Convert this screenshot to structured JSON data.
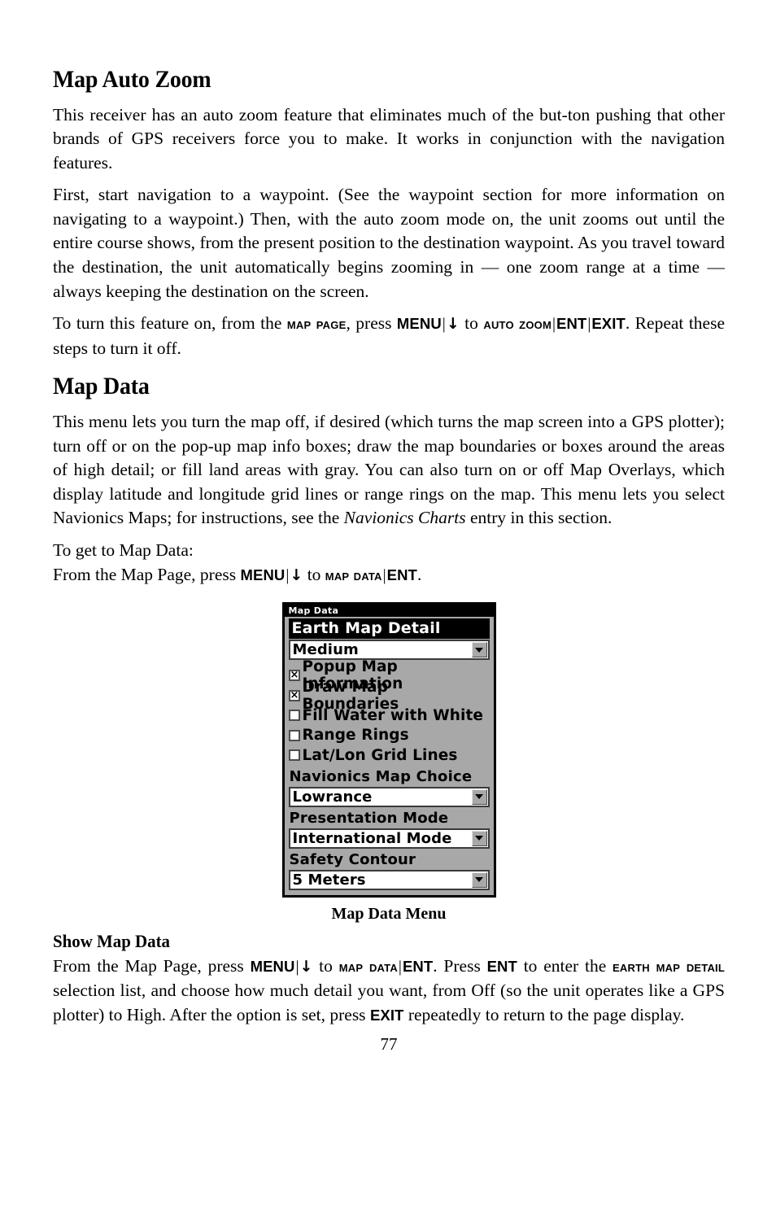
{
  "document": {
    "page_number": "77"
  },
  "sections": [
    {
      "heading": "Map Auto Zoom",
      "paragraphs": [
        "This receiver has an auto zoom feature that eliminates much of the but-ton pushing that other brands of GPS receivers force you to make. It works in conjunction with the navigation features.",
        "First, start navigation to a waypoint. (See the waypoint section for more information on navigating to a waypoint.) Then, with the auto zoom mode on, the unit zooms out until the entire course shows, from the present position to the destination waypoint. As you travel toward the destination, the unit automatically begins zooming in — one zoom range at a time — always keeping the destination on the screen."
      ]
    }
  ],
  "auto_zoom_instruction": {
    "lead": "To turn this feature on, from the ",
    "page_key": "Map Page",
    "mid1": ", press ",
    "menu_key": "MENU",
    "sep": "|",
    "down_arrow": "↓",
    "mid2": " to ",
    "auto_zoom_key": "Auto Zoom",
    "ent_key": "ENT",
    "exit_key": "EXIT",
    "tail": ". Repeat these steps to turn it off."
  },
  "map_data": {
    "heading": "Map Data",
    "paragraph_1": "This menu lets you turn the map off, if desired (which turns the map screen into a GPS plotter); turn off or on the pop-up map info boxes; draw the map boundaries or boxes around the areas of high detail; or fill land areas with gray. You can also turn on or off Map Overlays, which display latitude and longitude grid lines or range rings on the map. This menu lets you select Navionics Maps; for instructions, see the ",
    "italic_ref": "Navionics Charts",
    "paragraph_1_tail": " entry in this section.",
    "to_get_line": "To get to Map Data:",
    "from_line_lead": "From the Map Page, press ",
    "menu_key": "MENU",
    "down_arrow": "↓",
    "mid": " to ",
    "map_data_key": "Map Data",
    "ent_key": "ENT",
    "tail": "."
  },
  "device_screenshot": {
    "title": "Map Data",
    "highlighted_row": "Earth Map Detail",
    "earth_map_detail_value": "Medium",
    "checkboxes": [
      {
        "label": "Popup Map Information",
        "checked": true,
        "mark": "×"
      },
      {
        "label": "Draw Map Boundaries",
        "checked": true,
        "mark": "×"
      },
      {
        "label": "Fill Water with White",
        "checked": false,
        "mark": ""
      },
      {
        "label": "Range Rings",
        "checked": false,
        "mark": ""
      },
      {
        "label": "Lat/Lon Grid Lines",
        "checked": false,
        "mark": ""
      }
    ],
    "fields": [
      {
        "label": "Navionics Map Choice",
        "value": "Lowrance"
      },
      {
        "label": "Presentation Mode",
        "value": "International Mode"
      },
      {
        "label": "Safety Contour",
        "value": "5 Meters"
      }
    ],
    "caption": "Map Data Menu"
  },
  "show_map_data": {
    "heading": "Show Map Data",
    "lead": "From the Map Page, press ",
    "menu_key": "MENU",
    "down_arrow": "↓",
    "mid1": " to ",
    "map_data_key": "Map Data",
    "ent_key": "ENT",
    "mid2": ". Press ",
    "ent_key_2": "ENT",
    "mid3": " to enter the ",
    "earth_map_detail_key": "Earth Map Detail",
    "body": " selection list, and choose how much detail you want, from Off (so the unit operates like a GPS plotter) to High. After the option is set, press ",
    "exit_key": "EXIT",
    "tail": " repeatedly to return to the page display."
  },
  "colors": {
    "device_background": "#a8a8a8",
    "device_border": "#000000",
    "highlight_background": "#000000",
    "highlight_text": "#ffffff",
    "field_background": "#ffffff",
    "page_background": "#ffffff",
    "text": "#000000"
  }
}
